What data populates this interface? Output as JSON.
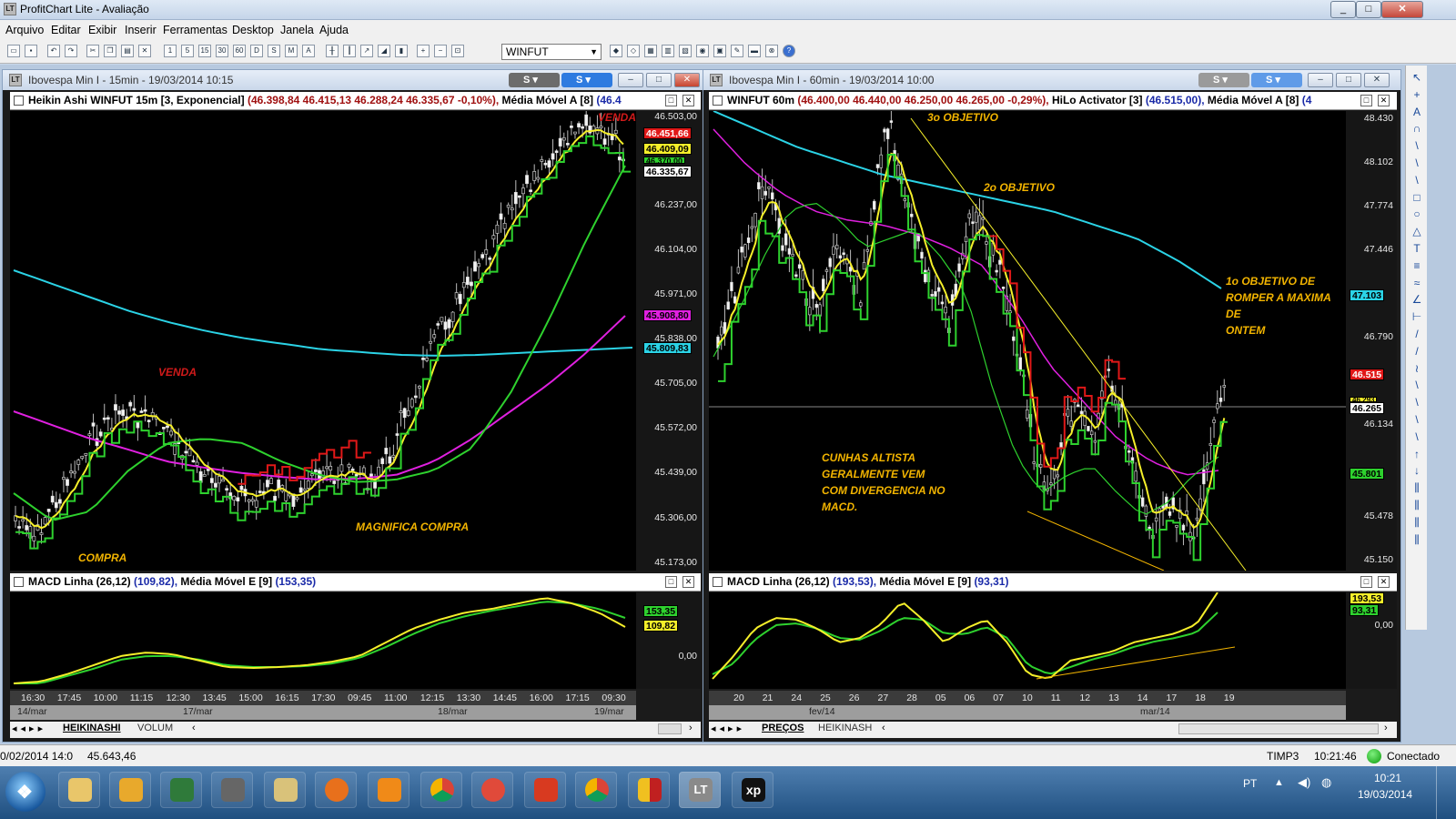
{
  "app": {
    "title": "ProfitChart Lite - Avaliação"
  },
  "menu": [
    "Arquivo",
    "Editar",
    "Exibir",
    "Inserir",
    "Ferramentas",
    "Desktop",
    "Janela",
    "Ajuda"
  ],
  "toolbar": {
    "symbol": "WINFUT"
  },
  "left": {
    "title": "Ibovespa Min I - 15min - 19/03/2014 10:15",
    "pill_label": "S",
    "header": {
      "name": "Heikin Ashi WINFUT 15m [3, Exponencial]",
      "values": "(46.398,84  46.415,13  46.288,24  46.335,67  -0,10%),",
      "ind": "Média Móvel A [8]",
      "tail": "(46.4"
    },
    "price_ticks": [
      "46.503,00",
      "46.237,00",
      "46.104,00",
      "45.971,00",
      "45.838,00",
      "45.705,00",
      "45.572,00",
      "45.439,00",
      "45.306,00",
      "45.173,00"
    ],
    "tags": [
      "46.451,66",
      "46.409,09",
      "46.370,00",
      "46.335,67",
      "45.908,80",
      "45.809,83"
    ],
    "annotations": {
      "venda_top": "VENDA",
      "venda": "VENDA",
      "compra": "COMPRA",
      "magnifica": "MAGNIFICA COMPRA"
    },
    "macd_header": {
      "name": "MACD Linha (26,12)",
      "v1": "(109,82),",
      "ind": "Média Móvel E [9]",
      "v2": "(153,35)"
    },
    "macd_tags": [
      "153,35",
      "109,82"
    ],
    "macd_zero": "0,00",
    "x_ticks": [
      "16:30",
      "17:45",
      "10:00",
      "11:15",
      "12:30",
      "13:45",
      "15:00",
      "16:15",
      "17:30",
      "09:45",
      "11:00",
      "12:15",
      "13:30",
      "14:45",
      "16:00",
      "17:15",
      "09:30"
    ],
    "dates": [
      "14/mar",
      "17/mar",
      "18/mar",
      "19/mar"
    ],
    "tabs": [
      "HEIKINASHI",
      "VOLUM"
    ]
  },
  "right": {
    "title": "Ibovespa Min I - 60min - 19/03/2014 10:00",
    "pill_label": "S",
    "header": {
      "name": "WINFUT 60m",
      "values": "(46.400,00  46.440,00  46.250,00  46.265,00  -0,29%),",
      "ind": "HiLo Activator [3]",
      "v2": "(46.515,00),",
      "ind2": "Média Móvel A [8]",
      "tail": "(4"
    },
    "price_ticks": [
      "48.430",
      "48.102",
      "47.774",
      "47.446",
      "47.103",
      "46.790",
      "46.462",
      "46.134",
      "45.806",
      "45.478",
      "45.150"
    ],
    "tags": [
      "47.103",
      "46.515",
      "46.293",
      "46.265",
      "45.801"
    ],
    "annotations": {
      "obj3": "3o OBJETIVO",
      "obj2": "2o OBJETIVO",
      "obj1": [
        "1o OBJETIVO DE",
        "ROMPER A MAXIMA DE",
        "ONTEM"
      ],
      "cunhas": [
        "CUNHAS ALTISTA",
        "GERALMENTE VEM",
        "COM DIVERGENCIA NO",
        "MACD."
      ]
    },
    "macd_header": {
      "name": "MACD Linha (26,12)",
      "v1": "(193,53),",
      "ind": "Média Móvel E [9]",
      "v2": "(93,31)"
    },
    "macd_tags": [
      "193,53",
      "93,31"
    ],
    "macd_zero": "0,00",
    "x_ticks": [
      "20",
      "21",
      "24",
      "25",
      "26",
      "27",
      "28",
      "05",
      "06",
      "07",
      "10",
      "11",
      "12",
      "13",
      "14",
      "17",
      "18",
      "19"
    ],
    "dates": [
      "fev/14",
      "mar/14"
    ],
    "tabs": [
      "PREÇOS",
      "HEIKINASH"
    ]
  },
  "status": {
    "left1": "0/02/2014 14:0",
    "left2": "45.643,46",
    "server": "TIMP3",
    "time": "10:21:46",
    "conn": "Conectado"
  },
  "taskbar": {
    "lang": "PT",
    "clock_time": "10:21",
    "clock_date": "19/03/2014"
  },
  "colors": {
    "cyan": "#2bd3e6",
    "magenta": "#e020e0",
    "yellow": "#f5ef2a",
    "green": "#2ed12e",
    "red": "#e01818",
    "annotation": "#f2b400"
  }
}
